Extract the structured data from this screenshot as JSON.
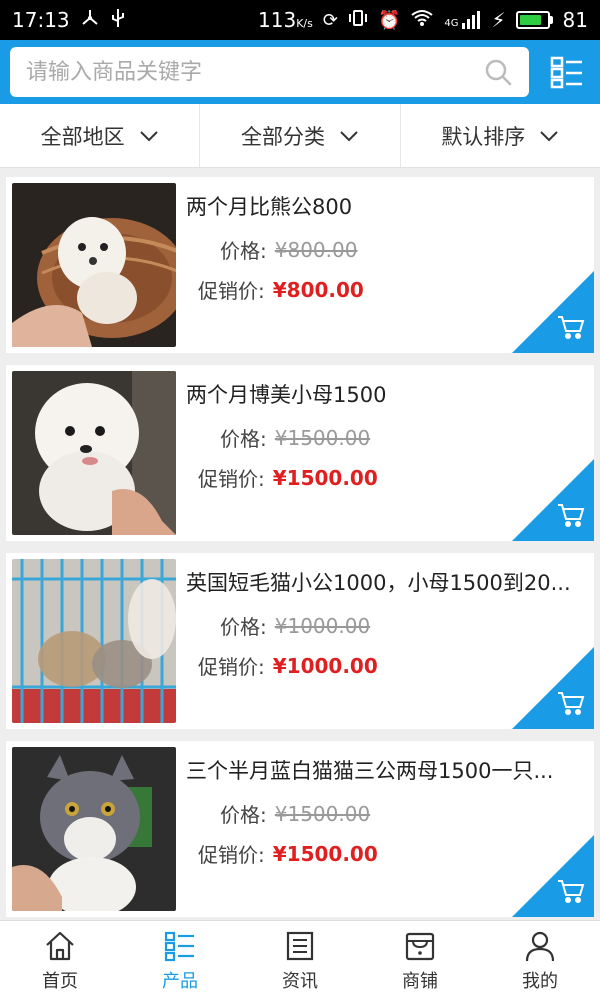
{
  "status_bar": {
    "time": "17:13",
    "net_speed": "113",
    "net_unit": "K/s",
    "network": "4G",
    "battery": "81",
    "battery_level": 0.81
  },
  "search": {
    "placeholder": "请输入商品关键字"
  },
  "filters": [
    {
      "label": "全部地区"
    },
    {
      "label": "全部分类"
    },
    {
      "label": "默认排序"
    }
  ],
  "price_label": "价格:",
  "promo_label": "促销价:",
  "products": [
    {
      "title": "两个月比熊公800",
      "price": "¥800.00",
      "promo_price": "¥800.00",
      "image": "white-puppy-in-basket"
    },
    {
      "title": "两个月博美小母1500",
      "price": "¥1500.00",
      "promo_price": "¥1500.00",
      "image": "white-pomeranian-puppy"
    },
    {
      "title": "英国短毛猫小公1000，小母1500到20...",
      "price": "¥1000.00",
      "promo_price": "¥1000.00",
      "image": "kittens-in-blue-cage"
    },
    {
      "title": "三个半月蓝白猫猫三公两母1500一只...",
      "price": "¥1500.00",
      "promo_price": "¥1500.00",
      "image": "blue-white-kitten"
    }
  ],
  "bottom_nav": [
    {
      "label": "首页",
      "icon": "home-icon"
    },
    {
      "label": "产品",
      "icon": "product-list-icon",
      "active": true
    },
    {
      "label": "资讯",
      "icon": "news-icon"
    },
    {
      "label": "商铺",
      "icon": "shop-icon"
    },
    {
      "label": "我的",
      "icon": "profile-icon"
    }
  ],
  "colors": {
    "accent": "#1a9be6",
    "promo": "#e02020"
  }
}
